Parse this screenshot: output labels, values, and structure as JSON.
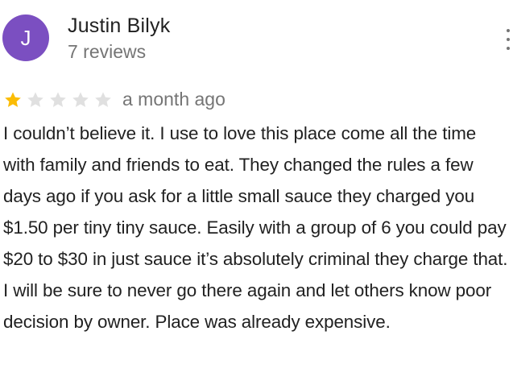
{
  "reviewer": {
    "avatar_initial": "J",
    "avatar_color": "#7b4fc1",
    "name": "Justin Bilyk",
    "review_count": "7 reviews"
  },
  "review": {
    "rating": 1,
    "max_rating": 5,
    "star_filled_color": "#fbbc04",
    "star_empty_color": "#e0e0e0",
    "time": "a month ago",
    "text": "I couldn’t believe it. I use to love this place come all the time with family and friends to eat. They changed the rules a few days ago if you ask for a little small sauce they charged you $1.50 per tiny tiny sauce. Easily with a group of 6 you could pay $20 to $30 in just sauce it’s absolutely criminal they charge that. I will be sure to never go there again and let others know poor decision by owner. Place was already expensive."
  },
  "icons": {
    "more": "more-vert-icon",
    "star": "star-icon"
  }
}
